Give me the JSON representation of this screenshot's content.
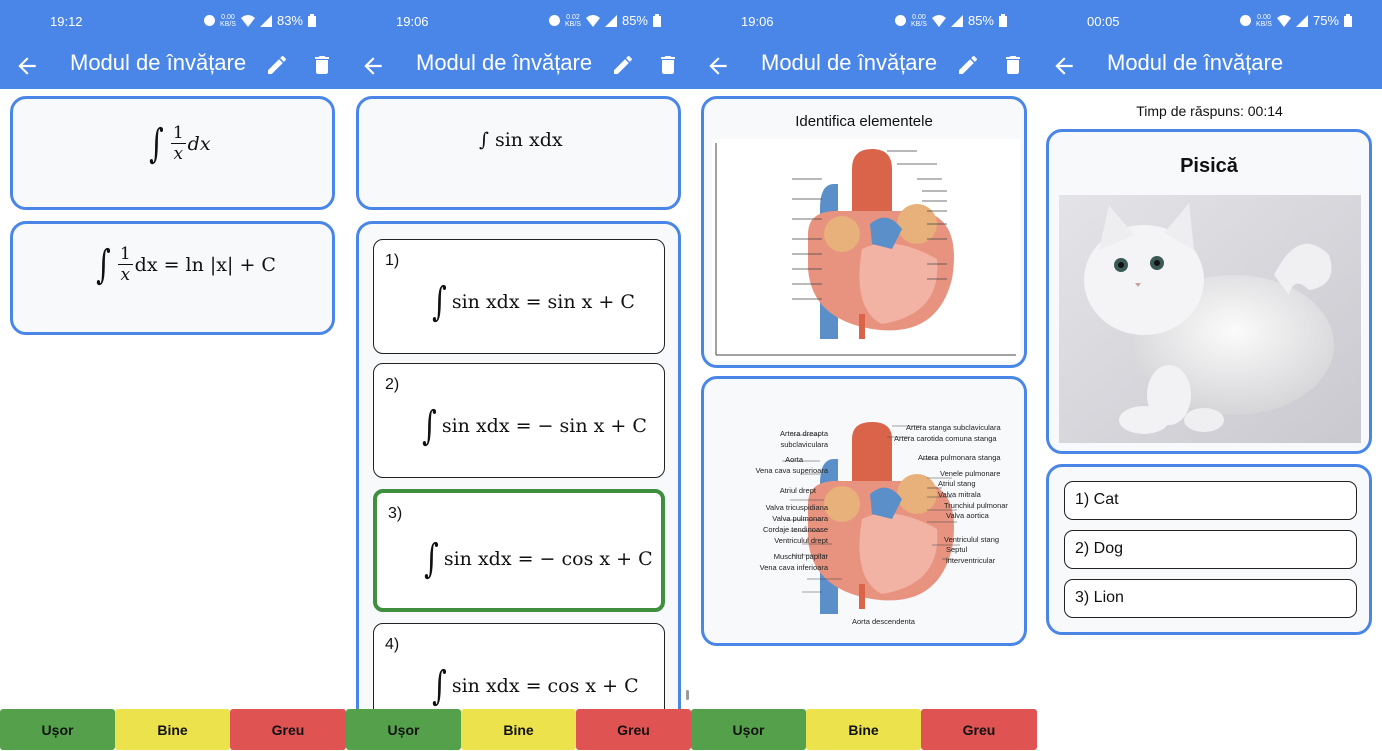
{
  "app": {
    "title": "Modul de învățare",
    "accent_color": "#4a86e8",
    "status_icons": [
      "data-saver-icon",
      "wifi-icon",
      "signal-icon",
      "battery-icon"
    ]
  },
  "screens": [
    {
      "status": {
        "time": "19:12",
        "net_speed_top": "0.00",
        "net_speed_unit": "KB/S",
        "battery": "83%"
      },
      "question_math": {
        "pre": "∫",
        "frac_num": "1",
        "frac_den": "x",
        "post": "dx"
      },
      "answer_math": {
        "pre": "∫",
        "frac_num": "1",
        "frac_den": "x",
        "post": "dx = ln |x| + C"
      }
    },
    {
      "status": {
        "time": "19:06",
        "net_speed_top": "0.02",
        "net_speed_unit": "KB/S",
        "battery": "85%"
      },
      "question_math": {
        "text": "∫ sin xdx"
      },
      "options": [
        {
          "label": "1)",
          "math": "sin xdx = sin x + C"
        },
        {
          "label": "2)",
          "math": "sin xdx = − sin x + C"
        },
        {
          "label": "3)",
          "math": "sin xdx = − cos x + C",
          "correct": true
        },
        {
          "label": "4)",
          "math": "sin xdx = cos x + C"
        }
      ]
    },
    {
      "status": {
        "time": "19:06",
        "net_speed_top": "0.00",
        "net_speed_unit": "KB/S",
        "battery": "85%"
      },
      "question_title": "Identifica elementele",
      "heart_labels_left": [
        "Artera dreapta",
        "subclaviculara",
        "Aorta",
        "Vena cava superioara",
        "Atriul drept",
        "Valva tricuspidiana",
        "Valva pulmonara",
        "Cordaje tendinoase",
        "Ventriculul drept",
        "Muschiul papilar",
        "Vena cava inferioara"
      ],
      "heart_labels_right": [
        "Artera stanga subclaviculara",
        "Artera carotida comuna stanga",
        "Artera pulmonara stanga",
        "Venele pulmonare",
        "Atriul stang",
        "Valva mitrala",
        "Trunchiul pulmonar",
        "Valva aortica",
        "Ventriculul stang",
        "Septul",
        "interventricular"
      ],
      "heart_label_bottom": "Aorta descendenta"
    },
    {
      "status": {
        "time": "00:05",
        "net_speed_top": "0.00",
        "net_speed_unit": "KB/S",
        "battery": "75%"
      },
      "timer": "Timp de răspuns: 00:14",
      "word": "Pisică",
      "answers": [
        "1) Cat",
        "2) Dog",
        "3) Lion"
      ]
    }
  ],
  "footer": {
    "easy": "Ușor",
    "good": "Bine",
    "hard": "Greu"
  },
  "colors": {
    "easy": "#55a14b",
    "good": "#ece34c",
    "hard": "#e05353",
    "correct_border": "#3f8f3f"
  }
}
